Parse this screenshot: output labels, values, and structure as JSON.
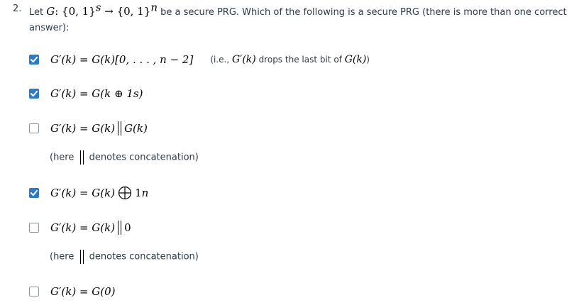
{
  "question": {
    "number": "2.",
    "lead": "Let",
    "G": "G",
    "sig": ": {0, 1}",
    "sig_sup1": "s",
    "arrow": " → {0, 1}",
    "sig_sup2": "n",
    "rest": "be a secure PRG. Which of the following is a secure PRG  (there is more than one correct answer):"
  },
  "options": [
    {
      "checked": true,
      "lhs": "G′(k) = G(k)[0, . . . , n − 2]",
      "note_pre": "(i.e., ",
      "note_m1": "G′(k)",
      "note_mid": " drops the last bit of ",
      "note_m2": "G(k)",
      "note_post": ")"
    },
    {
      "checked": true,
      "lhs": "G′(k) = G(k ⊕ 1",
      "sup": "s",
      "rhs": ")"
    },
    {
      "checked": false,
      "lhs": "G′(k) = G(k)",
      "rhs": "G(k)",
      "note_pre": "(here",
      "note_post": "denotes concatenation)"
    },
    {
      "checked": true,
      "lhs": "G′(k) = G(k)",
      "rhs": "1",
      "sup": "n"
    },
    {
      "checked": false,
      "lhs": "G′(k) = G(k)",
      "rhs": "0",
      "note_pre": "(here",
      "note_post": "denotes concatenation)"
    },
    {
      "checked": false,
      "lhs": "G′(k) = G(0)"
    }
  ],
  "colors": {
    "checkbox_checked": "#2a7ac9",
    "text": "#2d3b45"
  }
}
